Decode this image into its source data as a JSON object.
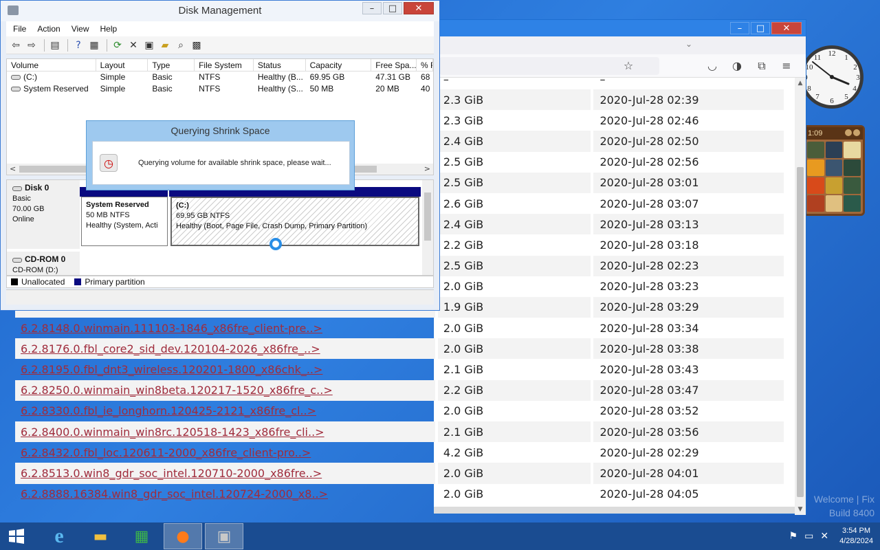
{
  "disk_mgmt": {
    "title": "Disk Management",
    "menu": [
      "File",
      "Action",
      "View",
      "Help"
    ],
    "columns": [
      "Volume",
      "Layout",
      "Type",
      "File System",
      "Status",
      "Capacity",
      "Free Spa...",
      "% F"
    ],
    "volumes": [
      [
        "(C:)",
        "Simple",
        "Basic",
        "NTFS",
        "Healthy (B...",
        "69.95 GB",
        "47.31 GB",
        "68"
      ],
      [
        "System Reserved",
        "Simple",
        "Basic",
        "NTFS",
        "Healthy (S...",
        "50 MB",
        "20 MB",
        "40"
      ]
    ],
    "disk0": {
      "name": "Disk 0",
      "type": "Basic",
      "size": "70.00 GB",
      "state": "Online",
      "part1": {
        "name": "System Reserved",
        "size": "50 MB NTFS",
        "status": "Healthy (System, Acti"
      },
      "part2": {
        "name": "(C:)",
        "size": "69.95 GB NTFS",
        "status": "Healthy (Boot, Page File, Crash Dump, Primary Partition)"
      }
    },
    "cdrom0": {
      "name": "CD-ROM 0",
      "drive": "CD-ROM (D:)"
    },
    "legend": {
      "unallocated": "Unallocated",
      "primary": "Primary partition"
    },
    "colors": {
      "unallocated": "#000000",
      "primary": "#0a0a80"
    }
  },
  "dialog": {
    "title": "Querying Shrink Space",
    "message": "Querying volume for available shrink space, please wait..."
  },
  "listing": {
    "header_dash_size": "–",
    "header_dash_date": "–",
    "rows": [
      {
        "name": "",
        "size": "2.3 GiB",
        "date": "2020-Jul-28 02:39"
      },
      {
        "name": "",
        "size": "2.3 GiB",
        "date": "2020-Jul-28 02:46"
      },
      {
        "name": "",
        "size": "2.4 GiB",
        "date": "2020-Jul-28 02:50"
      },
      {
        "name": "",
        "size": "2.5 GiB",
        "date": "2020-Jul-28 02:56"
      },
      {
        "name": "",
        "size": "2.5 GiB",
        "date": "2020-Jul-28 03:01"
      },
      {
        "name": "",
        "size": "2.6 GiB",
        "date": "2020-Jul-28 03:07"
      },
      {
        "name": "",
        "size": "2.4 GiB",
        "date": "2020-Jul-28 03:13"
      },
      {
        "name": "",
        "size": "2.2 GiB",
        "date": "2020-Jul-28 03:18"
      },
      {
        "name": "",
        "size": "2.5 GiB",
        "date": "2020-Jul-28 02:23"
      },
      {
        "name": "",
        "size": "2.0 GiB",
        "date": "2020-Jul-28 03:23"
      },
      {
        "name": "",
        "size": "1.9 GiB",
        "date": "2020-Jul-28 03:29"
      },
      {
        "name": "6.2.8148.0.winmain.111103-1846_x86fre_client-pre..>",
        "size": "2.0 GiB",
        "date": "2020-Jul-28 03:34"
      },
      {
        "name": "6.2.8176.0.fbl_core2_sid_dev.120104-2026_x86fre_..>",
        "size": "2.0 GiB",
        "date": "2020-Jul-28 03:38"
      },
      {
        "name": "6.2.8195.0.fbl_dnt3_wireless.120201-1800_x86chk_..>",
        "size": "2.1 GiB",
        "date": "2020-Jul-28 03:43"
      },
      {
        "name": "6.2.8250.0.winmain_win8beta.120217-1520_x86fre_c..>",
        "size": "2.2 GiB",
        "date": "2020-Jul-28 03:47"
      },
      {
        "name": "6.2.8330.0.fbl_ie_longhorn.120425-2121_x86fre_cl..>",
        "size": "2.0 GiB",
        "date": "2020-Jul-28 03:52"
      },
      {
        "name": "6.2.8400.0.winmain_win8rc.120518-1423_x86fre_cli..>",
        "size": "2.1 GiB",
        "date": "2020-Jul-28 03:56"
      },
      {
        "name": "6.2.8432.0.fbl_loc.120611-2000_x86fre_client-pro..>",
        "size": "4.2 GiB",
        "date": "2020-Jul-28 02:29"
      },
      {
        "name": "6.2.8513.0.win8_gdr_soc_intel.120710-2000_x86fre..>",
        "size": "2.0 GiB",
        "date": "2020-Jul-28 04:01"
      },
      {
        "name": "6.2.8888.16384.win8_gdr_soc_intel.120724-2000_x8..>",
        "size": "2.0 GiB",
        "date": "2020-Jul-28 04:05"
      }
    ]
  },
  "gadgets": {
    "puzzle_time": "1:09"
  },
  "taskbar": {
    "time": "3:54 PM",
    "date": "4/28/2024"
  },
  "watermark": {
    "line1": "Welcome | Fix",
    "line2": "Build 8400"
  }
}
